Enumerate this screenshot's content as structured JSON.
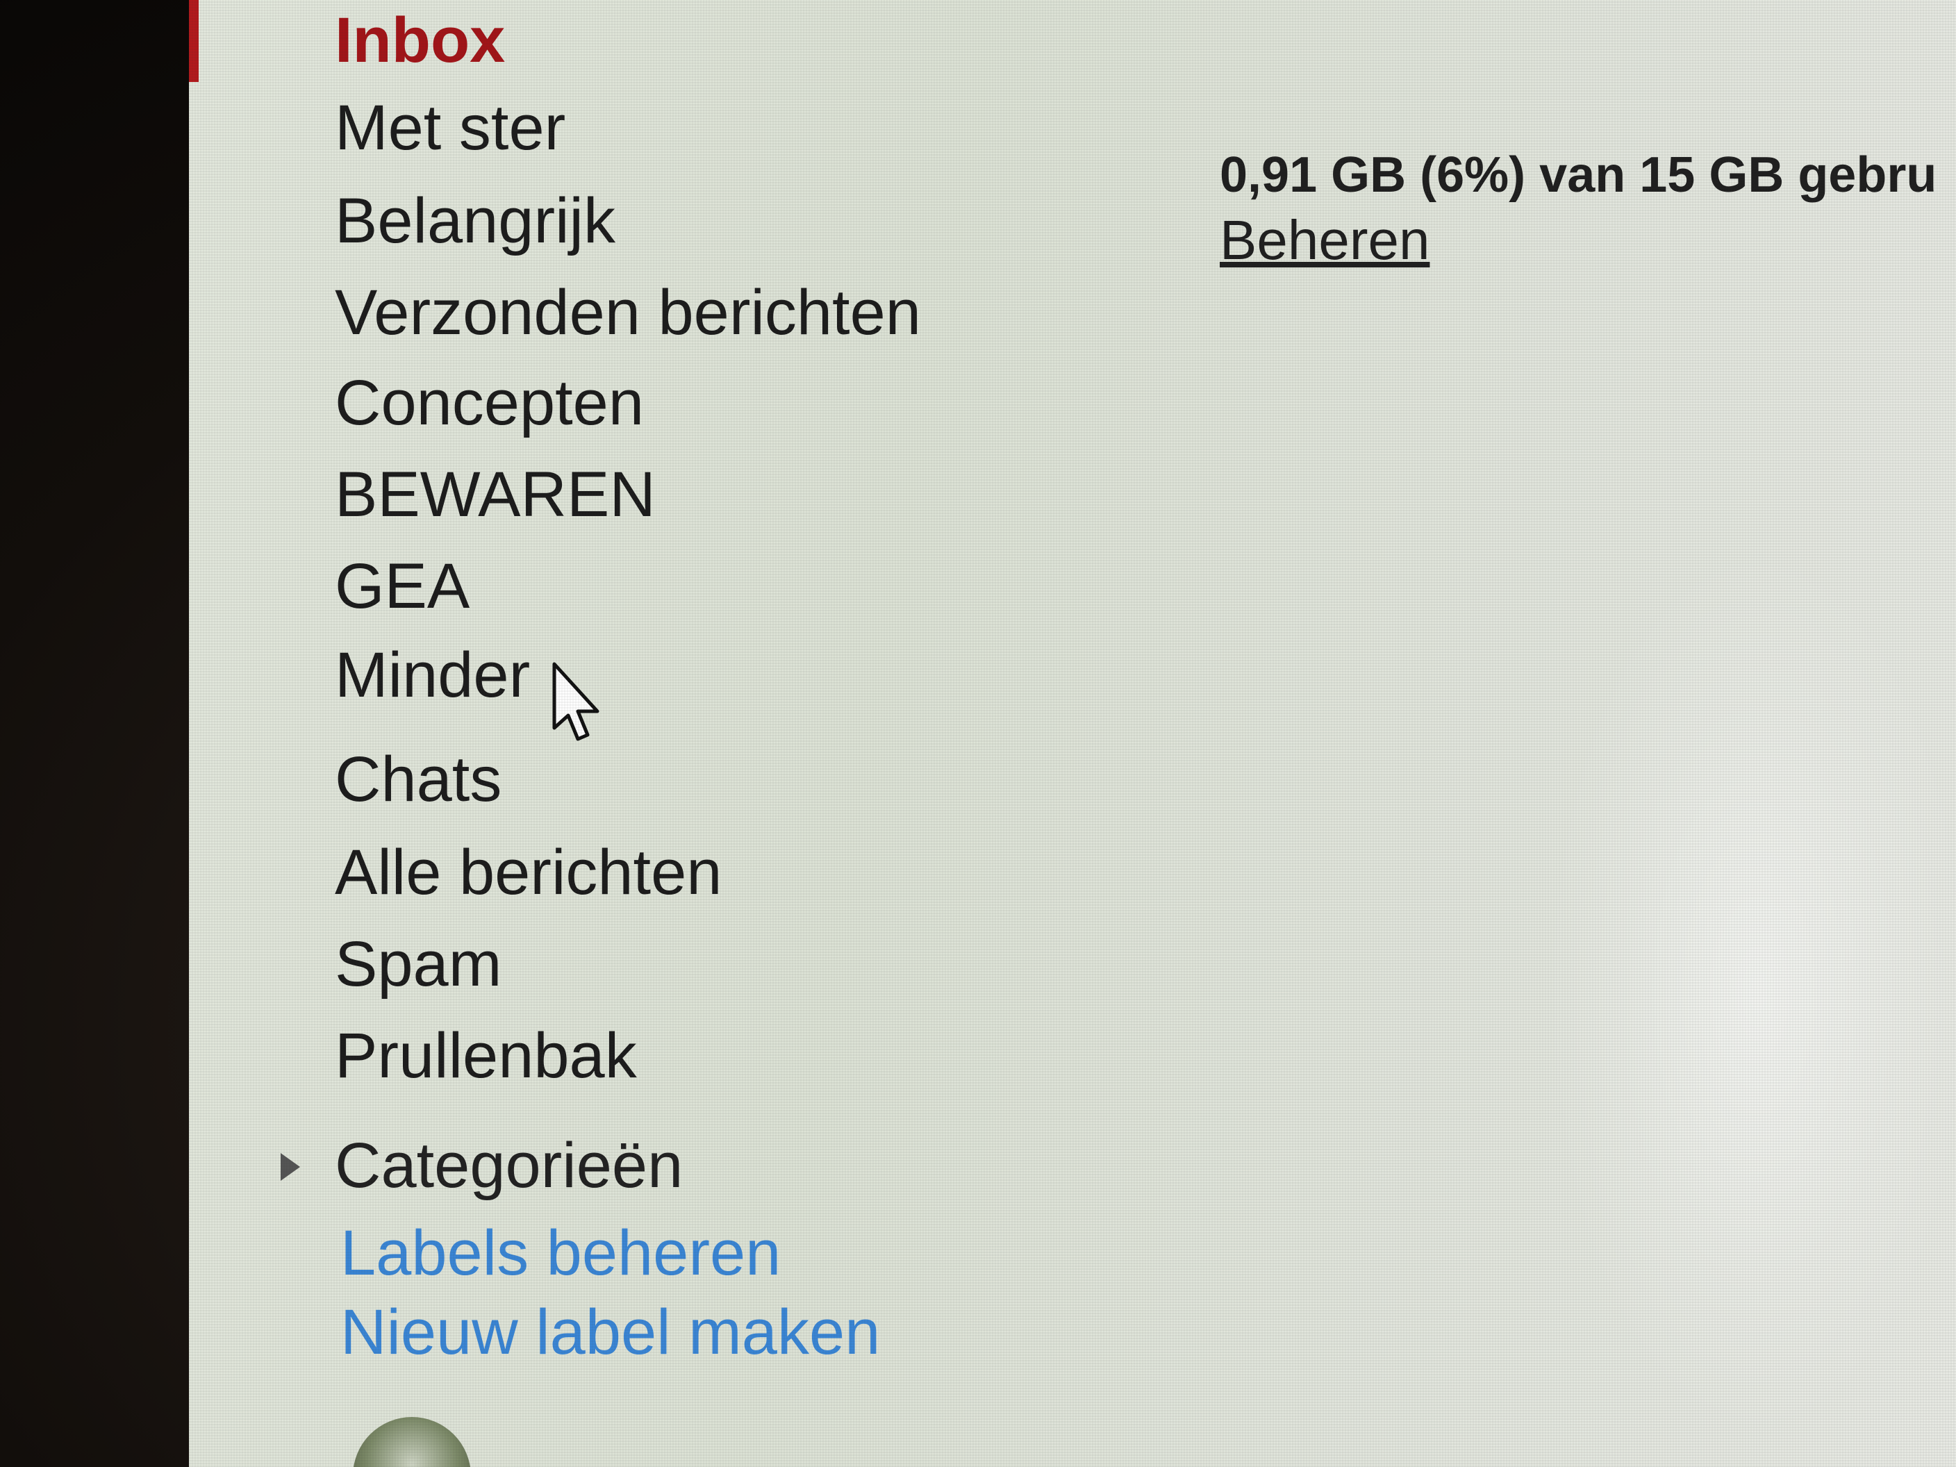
{
  "sidebar": {
    "items": [
      {
        "label": "Inbox",
        "active": true
      },
      {
        "label": "Met ster"
      },
      {
        "label": "Belangrijk"
      },
      {
        "label": "Verzonden berichten"
      },
      {
        "label": "Concepten"
      },
      {
        "label": "BEWAREN"
      },
      {
        "label": "GEA"
      },
      {
        "label": "Minder"
      },
      {
        "label": "Chats"
      },
      {
        "label": "Alle berichten"
      },
      {
        "label": "Spam"
      },
      {
        "label": "Prullenbak"
      }
    ],
    "categories_label": "Categorieën",
    "manage_labels": "Labels beheren",
    "new_label": "Nieuw label maken"
  },
  "storage": {
    "usage_text": "0,91 GB (6%) van 15 GB gebru",
    "manage_link": "Beheren"
  },
  "colors": {
    "active": "#a31418",
    "link": "#3a86d6",
    "text": "#1c1c1c"
  }
}
